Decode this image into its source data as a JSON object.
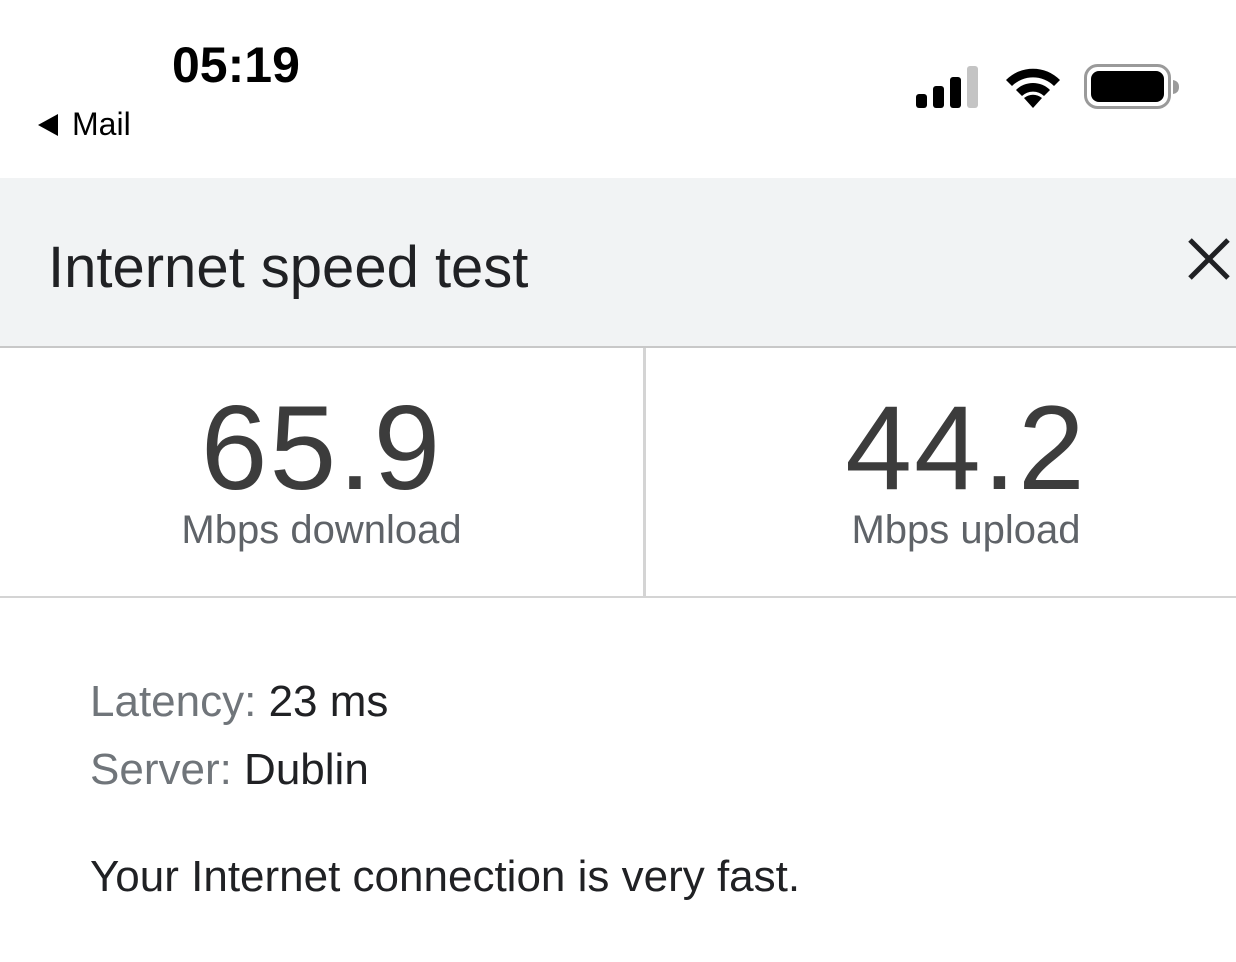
{
  "status_bar": {
    "time": "05:19",
    "back_label": "Mail"
  },
  "header": {
    "title": "Internet speed test"
  },
  "results": {
    "download": {
      "value": "65.9",
      "unit": "Mbps download"
    },
    "upload": {
      "value": "44.2",
      "unit": "Mbps upload"
    }
  },
  "details": {
    "latency_label": "Latency:",
    "latency_value": "23 ms",
    "server_label": "Server:",
    "server_value": "Dublin"
  },
  "summary": "Your Internet connection is very fast.",
  "icons": {
    "back": "back-triangle-icon",
    "signal": "cellular-signal-icon",
    "wifi": "wifi-icon",
    "battery": "battery-icon",
    "close": "close-icon"
  }
}
